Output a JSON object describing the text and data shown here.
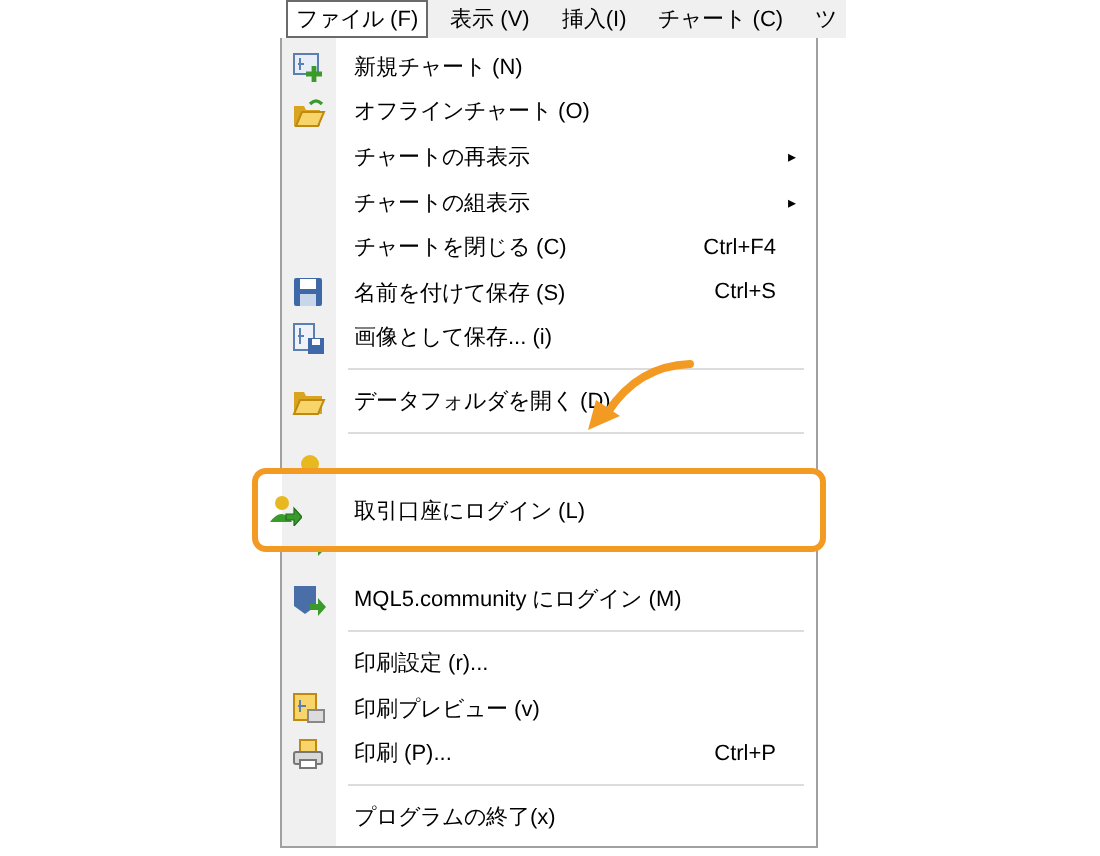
{
  "menubar": [
    {
      "label": "ファイル (F)",
      "selected": true
    },
    {
      "label": "表示 (V)",
      "selected": false
    },
    {
      "label": "挿入(I)",
      "selected": false
    },
    {
      "label": "チャート (C)",
      "selected": false
    },
    {
      "label": "ツ",
      "selected": false
    }
  ],
  "menu": [
    {
      "kind": "command",
      "label": "新規チャート (N)"
    },
    {
      "kind": "command",
      "label": "オフラインチャート (O)"
    },
    {
      "kind": "submenu",
      "label": "チャートの再表示",
      "arrow": "▸"
    },
    {
      "kind": "submenu",
      "label": "チャートの組表示",
      "arrow": "▸"
    },
    {
      "kind": "command",
      "label": "チャートを閉じる (C)",
      "shortcut": "Ctrl+F4"
    },
    {
      "kind": "command",
      "label": "名前を付けて保存 (S)",
      "shortcut": "Ctrl+S"
    },
    {
      "kind": "command",
      "label": "画像として保存... (i)"
    },
    {
      "kind": "separator"
    },
    {
      "kind": "command",
      "label": "データフォルダを開く (D)"
    },
    {
      "kind": "separator"
    },
    {
      "kind": "obscured"
    },
    {
      "kind": "command",
      "label": "取引口座にログイン (L)",
      "callout": true
    },
    {
      "kind": "obscured"
    },
    {
      "kind": "command",
      "label": "MQL5.community にログイン (M)"
    },
    {
      "kind": "separator"
    },
    {
      "kind": "command",
      "label": "印刷設定 (r)..."
    },
    {
      "kind": "command",
      "label": "印刷プレビュー (v)"
    },
    {
      "kind": "command",
      "label": "印刷 (P)...",
      "shortcut": "Ctrl+P"
    },
    {
      "kind": "separator"
    },
    {
      "kind": "command",
      "label": "プログラムの終了(x)"
    }
  ]
}
